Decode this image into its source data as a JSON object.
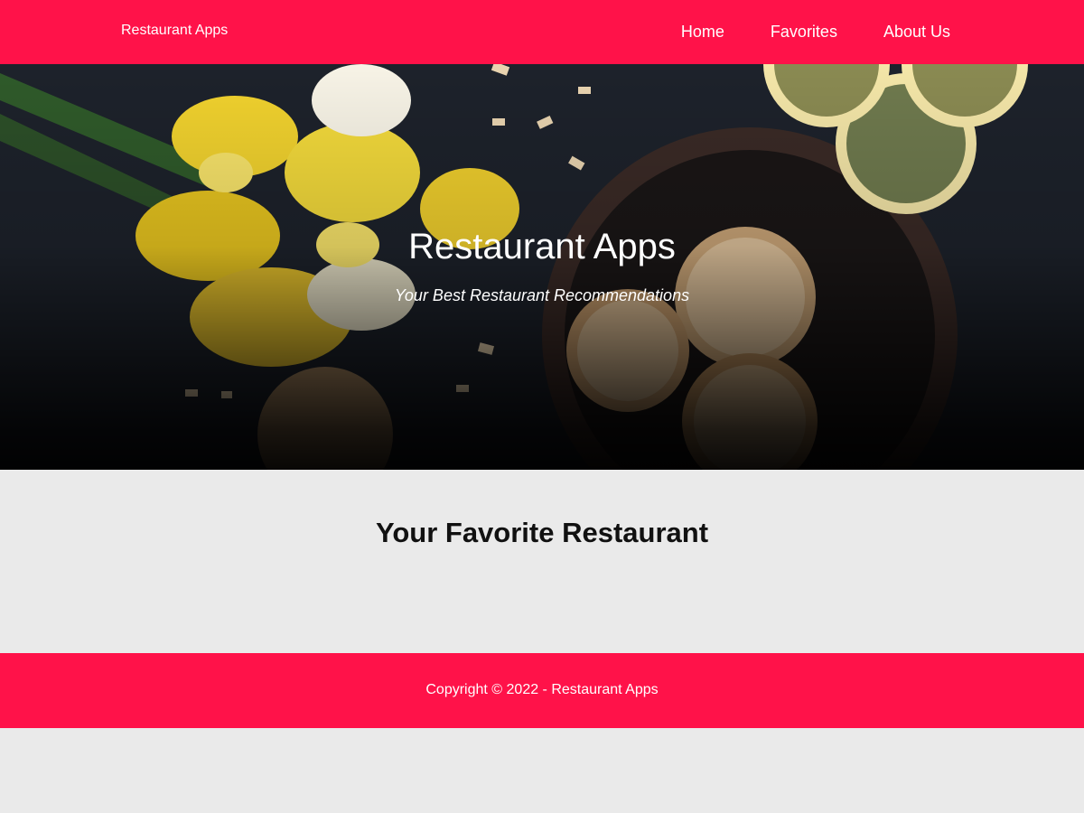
{
  "navbar": {
    "brand": "Restaurant Apps",
    "links": [
      {
        "label": "Home"
      },
      {
        "label": "Favorites"
      },
      {
        "label": "About Us"
      }
    ]
  },
  "hero": {
    "title": "Restaurant Apps",
    "tagline": "Your Best Restaurant Recommendations"
  },
  "main": {
    "section_title": "Your Favorite Restaurant"
  },
  "footer": {
    "copyright": "Copyright © 2022 - Restaurant Apps"
  },
  "colors": {
    "accent": "#ff1249",
    "page_background": "#eaeaea",
    "hero_background": "#1b1f27"
  }
}
